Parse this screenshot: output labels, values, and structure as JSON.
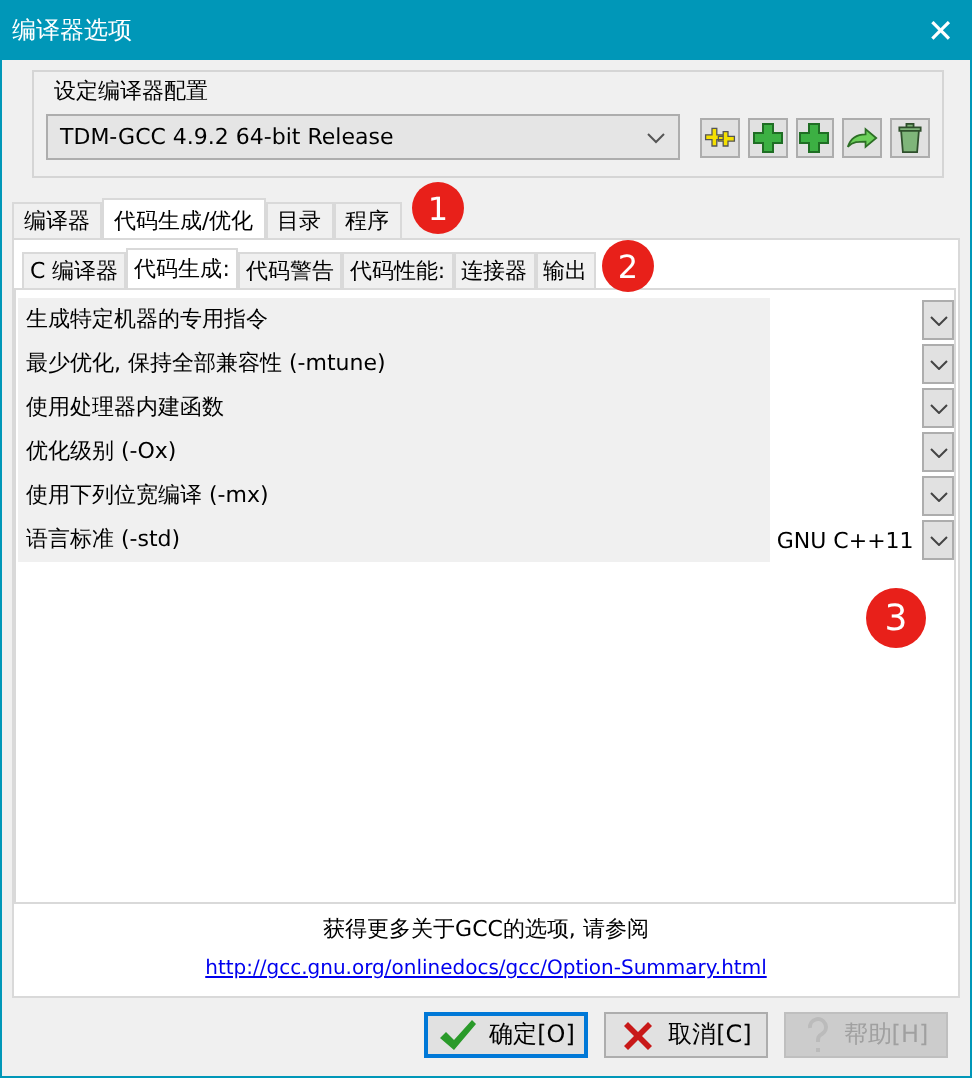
{
  "window": {
    "title": "编译器选项",
    "close": "✕"
  },
  "config": {
    "label": "设定编译器配置",
    "value": "TDM-GCC 4.9.2 64-bit Release",
    "tools": [
      {
        "kind": "double-plus"
      },
      {
        "kind": "plus"
      },
      {
        "kind": "plus"
      },
      {
        "kind": "arrow"
      },
      {
        "kind": "trash"
      }
    ]
  },
  "tabs": [
    {
      "label": "编译器",
      "selected": false
    },
    {
      "label": "代码生成/优化",
      "selected": true
    },
    {
      "label": "目录",
      "selected": false
    },
    {
      "label": "程序",
      "selected": false
    }
  ],
  "subtabs": [
    {
      "label": "C 编译器",
      "selected": false
    },
    {
      "label": "代码生成:",
      "selected": true
    },
    {
      "label": "代码警告",
      "selected": false
    },
    {
      "label": "代码性能:",
      "selected": false
    },
    {
      "label": "连接器",
      "selected": false
    },
    {
      "label": "输出",
      "selected": false
    }
  ],
  "options": [
    {
      "label": "生成特定机器的专用指令"
    },
    {
      "label": "最少优化, 保持全部兼容性 (-mtune)"
    },
    {
      "label": "使用处理器内建函数"
    },
    {
      "label": "优化级别 (-Ox)"
    },
    {
      "label": "使用下列位宽编译 (-mx)"
    },
    {
      "label": "语言标准 (-std)",
      "value": "GNU C++11"
    }
  ],
  "hint": "获得更多关于GCC的选项, 请参阅",
  "link": "http://gcc.gnu.org/onlinedocs/gcc/Option-Summary.html",
  "buttons": [
    {
      "label": "确定[O]",
      "kind": "ok",
      "default": true,
      "disabled": false
    },
    {
      "label": "取消[C]",
      "kind": "cancel",
      "default": false,
      "disabled": false
    },
    {
      "label": "帮助[H]",
      "kind": "help",
      "default": false,
      "disabled": true
    }
  ],
  "callouts": [
    "1",
    "2",
    "3"
  ]
}
